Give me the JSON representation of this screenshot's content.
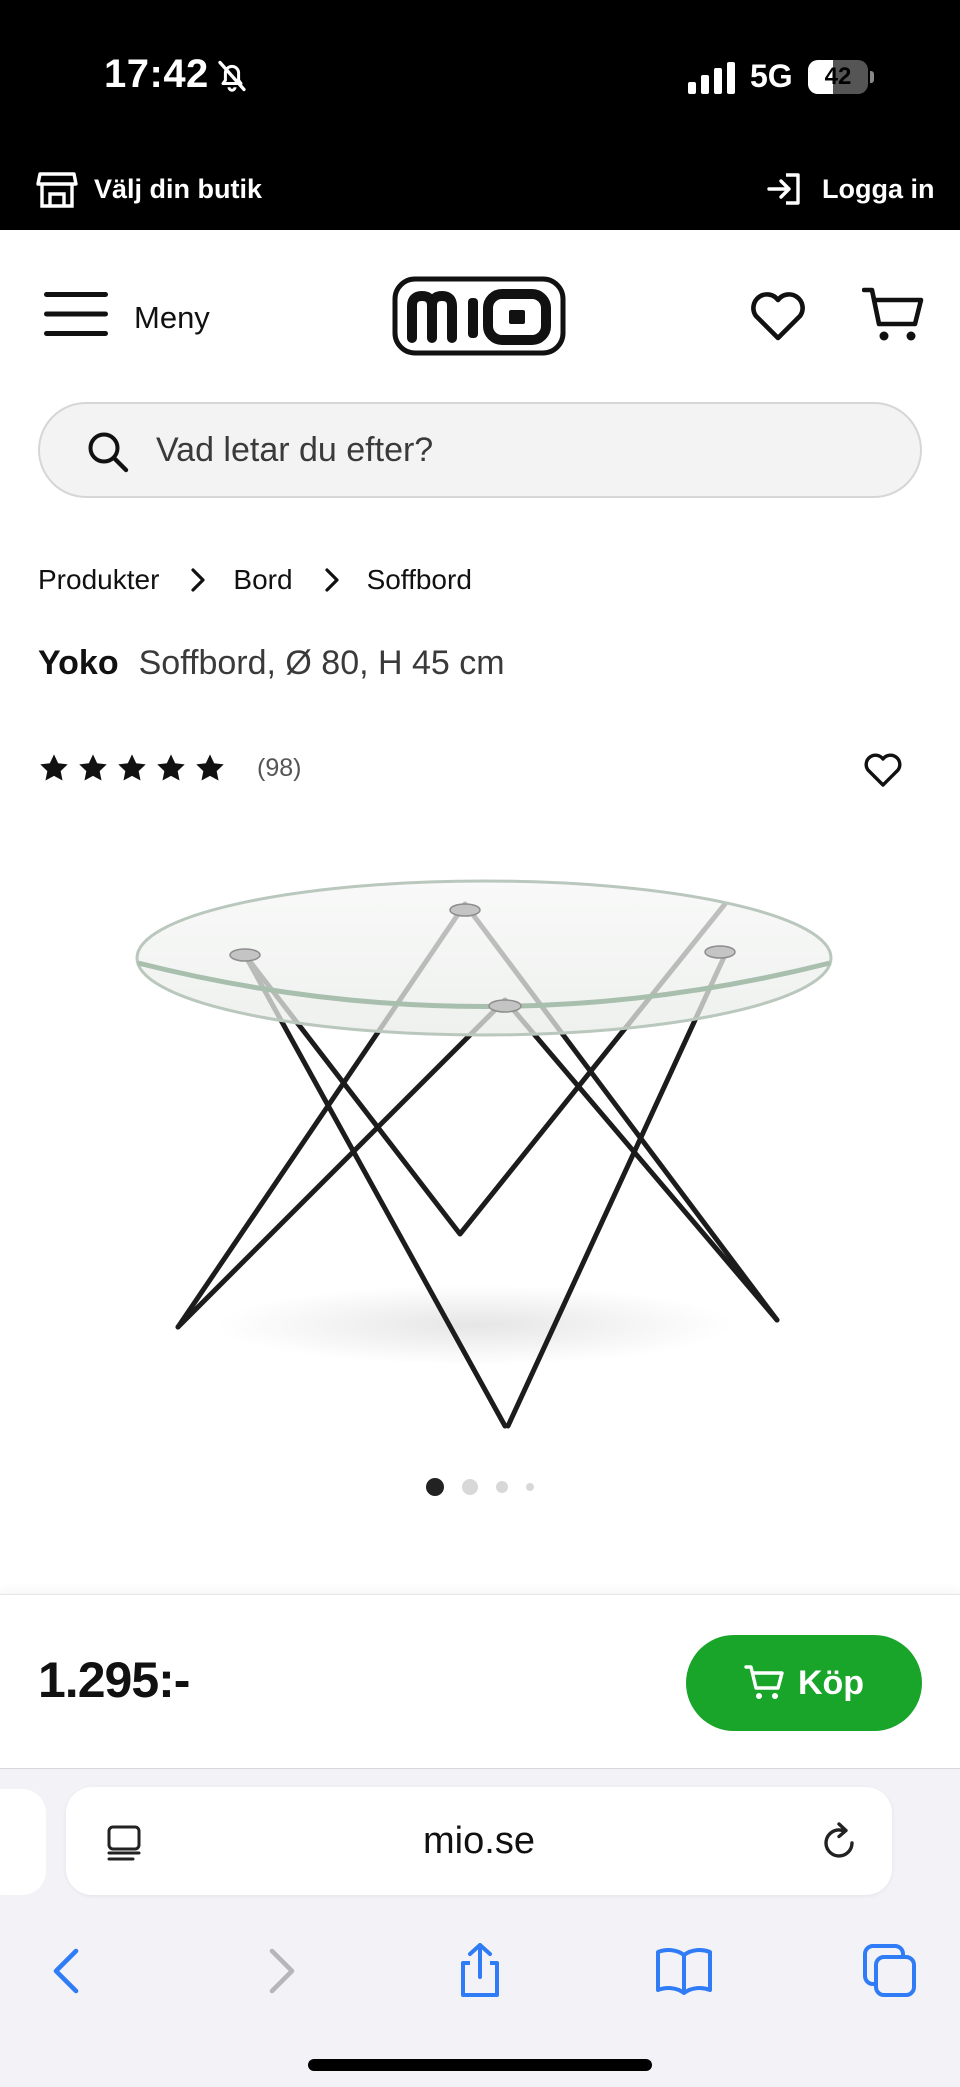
{
  "status_bar": {
    "time": "17:42",
    "network": "5G",
    "battery_percent": 42,
    "battery_label": "42"
  },
  "store_bar": {
    "store_label": "Välj din butik",
    "login_label": "Logga in"
  },
  "header": {
    "menu_label": "Meny",
    "logo_text": "mio"
  },
  "search": {
    "placeholder": "Vad letar du efter?"
  },
  "breadcrumb": [
    "Produkter",
    "Bord",
    "Soffbord"
  ],
  "product": {
    "brand": "Yoko",
    "name": "Soffbord, Ø 80, H 45 cm",
    "rating": 5,
    "review_count": "(98)",
    "image_count": 4,
    "active_image": 1,
    "price": "1.295:-",
    "buy_label": "Köp"
  },
  "browser": {
    "url": "mio.se"
  },
  "colors": {
    "accent_green": "#18a52a",
    "top_bar": "#000000",
    "search_bg": "#f3f3f3",
    "browser_blue": "#2f7cf6"
  },
  "icons": {
    "store": "store-icon",
    "login": "login-arrow-icon",
    "menu": "hamburger-menu-icon",
    "favorites": "heart-icon",
    "cart": "cart-icon",
    "search": "magnifier-icon",
    "reader": "reader-mode-icon",
    "reload": "reload-icon",
    "back": "chevron-left-icon",
    "forward": "chevron-right-icon",
    "share": "share-icon",
    "bookmarks": "open-book-icon",
    "tabs": "tabs-icon"
  }
}
